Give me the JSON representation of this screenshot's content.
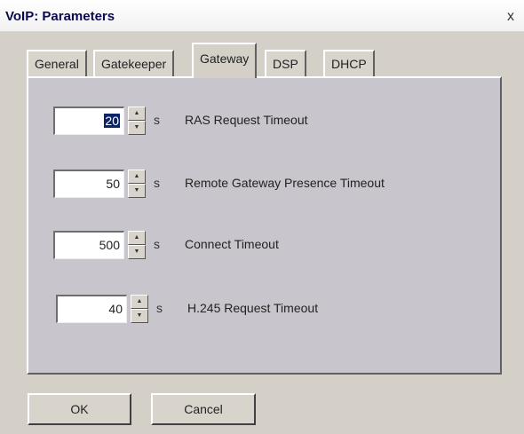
{
  "window": {
    "title": "VoIP: Parameters",
    "close_label": "x"
  },
  "tabs": [
    {
      "label": "General",
      "active": false
    },
    {
      "label": "Gatekeeper",
      "active": false
    },
    {
      "label": "Gateway",
      "active": true
    },
    {
      "label": "DSP",
      "active": false
    },
    {
      "label": "DHCP",
      "active": false
    }
  ],
  "fields": [
    {
      "value": "20",
      "unit": "s",
      "label": "RAS Request Timeout",
      "selected": true
    },
    {
      "value": "50",
      "unit": "s",
      "label": "Remote Gateway Presence Timeout",
      "selected": false
    },
    {
      "value": "500",
      "unit": "s",
      "label": "Connect Timeout",
      "selected": false
    },
    {
      "value": "40",
      "unit": "s",
      "label": "H.245 Request Timeout",
      "selected": false
    }
  ],
  "buttons": {
    "ok_label": "OK",
    "cancel_label": "Cancel"
  }
}
